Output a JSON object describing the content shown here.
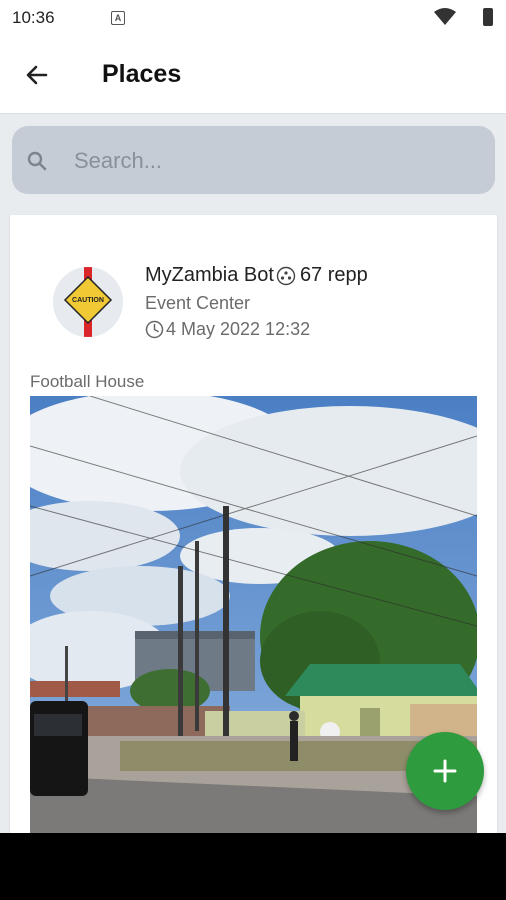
{
  "status_bar": {
    "time": "10:36",
    "notification_icon": "a-icon"
  },
  "app_bar": {
    "title": "Places",
    "back_icon": "arrow-left-icon"
  },
  "search": {
    "placeholder": "Search...",
    "value": ""
  },
  "post": {
    "author": "MyZambia Bot",
    "reputation": "67 repp",
    "category": "Event Center",
    "date": "4 May 2022 12:32",
    "place_name": "Football House",
    "avatar_sign_text": "CAUTION"
  },
  "fab": {
    "icon": "plus-icon"
  },
  "colors": {
    "accent": "#2e9b3e",
    "search_bg": "#c5ccd6",
    "app_bg": "#e9ecef"
  }
}
